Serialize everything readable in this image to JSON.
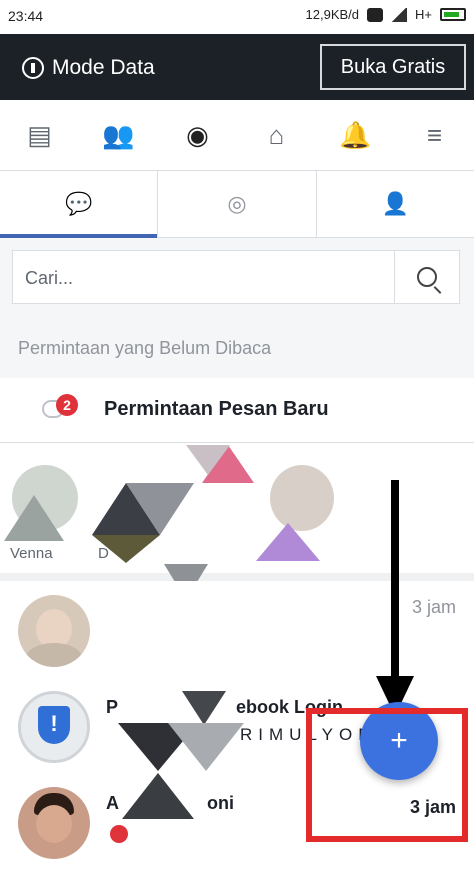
{
  "status_bar": {
    "time": "23:44",
    "speed": "12,9KB/d",
    "network": "H+"
  },
  "data_bar": {
    "mode_label": "Mode Data",
    "free_button": "Buka Gratis"
  },
  "nav": {
    "items": [
      {
        "name": "newsfeed",
        "glyph": "▤"
      },
      {
        "name": "friends",
        "glyph": "👥"
      },
      {
        "name": "messenger",
        "glyph": "◉"
      },
      {
        "name": "marketplace",
        "glyph": "⌂"
      },
      {
        "name": "notifications",
        "glyph": "🔔"
      },
      {
        "name": "menu",
        "glyph": "≡"
      }
    ]
  },
  "tabs": [
    {
      "name": "chats",
      "glyph": "💬"
    },
    {
      "name": "groups",
      "glyph": "◎"
    },
    {
      "name": "contacts",
      "glyph": "👤"
    }
  ],
  "search": {
    "placeholder": "Cari..."
  },
  "section": {
    "unread_requests_header": "Permintaan yang Belum Dibaca"
  },
  "requests": {
    "label": "Permintaan Pesan Baru",
    "badge": "2"
  },
  "active": {
    "names": [
      "Venna",
      "D"
    ]
  },
  "chats": [
    {
      "name": "",
      "snippet": "",
      "time": "3 jam"
    },
    {
      "name": "P",
      "snippet": "RIMULYON",
      "time": ""
    },
    {
      "name": "A",
      "snippet": "",
      "time": "3 jam"
    }
  ],
  "chat_name_fragments": {
    "row2_name_tail": "ebook Login",
    "row3_name_tail": "oni"
  },
  "fab": {
    "label": "+"
  },
  "colors": {
    "accent": "#4267b2",
    "fab": "#3b72e0",
    "highlight": "#e32b2b",
    "badge": "#e0323a"
  }
}
